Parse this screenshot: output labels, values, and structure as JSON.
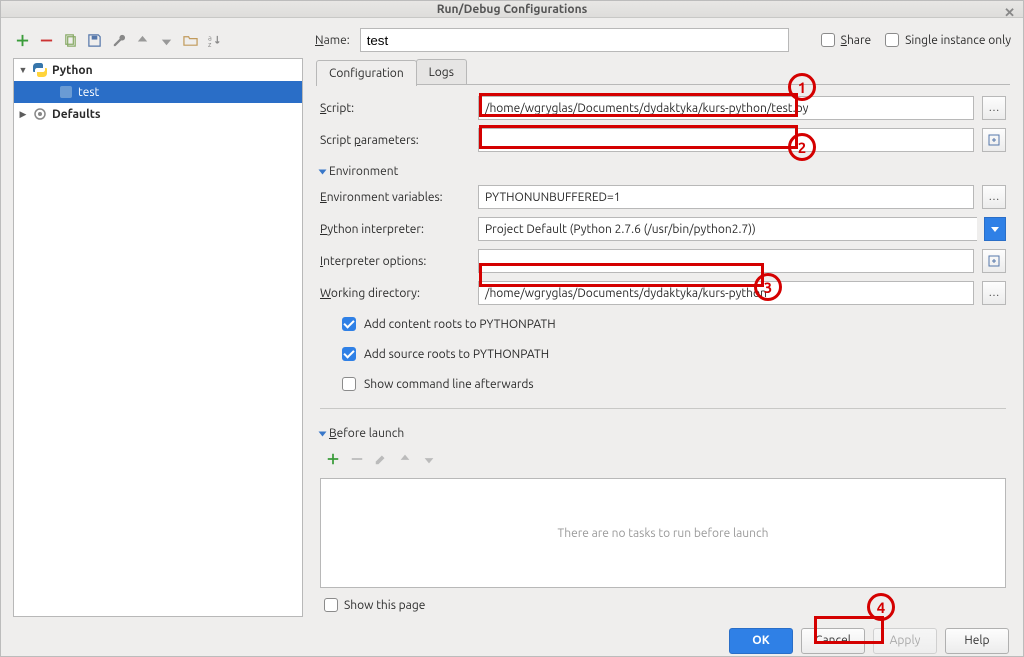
{
  "window": {
    "title": "Run/Debug Configurations"
  },
  "header": {
    "name_label": "Name:",
    "name_value": "test",
    "share_label": "Share",
    "single_instance_label": "Single instance only"
  },
  "tree": {
    "root": "Python",
    "items": [
      {
        "label": "test",
        "selected": true
      }
    ],
    "second_root": "Defaults"
  },
  "tabs": {
    "configuration": "Configuration",
    "logs": "Logs",
    "active": "configuration"
  },
  "fields": {
    "script": {
      "label": "Script:",
      "value": "/home/wgryglas/Documents/dydaktyka/kurs-python/test.py"
    },
    "script_params": {
      "label": "Script parameters:",
      "value": ""
    },
    "env_header": "Environment",
    "env_vars": {
      "label": "Environment variables:",
      "value": "PYTHONUNBUFFERED=1"
    },
    "interpreter": {
      "label": "Python interpreter:",
      "value": "Project Default (Python 2.7.6 (/usr/bin/python2.7))"
    },
    "interp_options": {
      "label": "Interpreter options:",
      "value": ""
    },
    "working_dir": {
      "label": "Working directory:",
      "value": "/home/wgryglas/Documents/dydaktyka/kurs-python"
    },
    "add_content_roots": "Add content roots to PYTHONPATH",
    "add_source_roots": "Add source roots to PYTHONPATH",
    "show_cmd_after": "Show command line afterwards"
  },
  "before_launch": {
    "header": "Before launch",
    "empty_text": "There are no tasks to run before launch",
    "show_this_page": "Show this page"
  },
  "buttons": {
    "ok": "OK",
    "cancel": "Cancel",
    "apply": "Apply",
    "help": "Help"
  },
  "annotations": {
    "a1": "1",
    "a2": "2",
    "a3": "3",
    "a4": "4"
  }
}
